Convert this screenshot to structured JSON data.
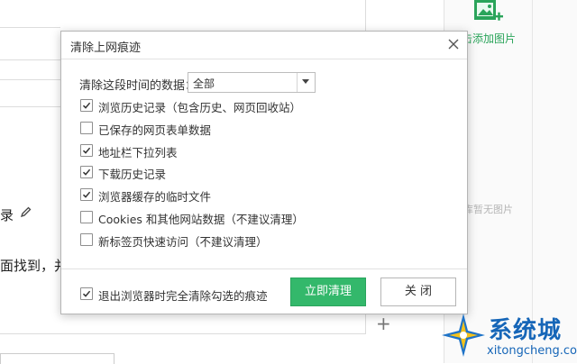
{
  "background": {
    "partial_text_1": "录",
    "partial_text_2": "面找到，并",
    "add_image_label": "击添加图片",
    "no_image_text": "库暂无图片"
  },
  "dialog": {
    "title": "清除上网痕迹",
    "range_label": "清除这段时间的数据：",
    "range_value": "全部",
    "options": [
      {
        "label": "浏览历史记录（包含历史、网页回收站）",
        "checked": true
      },
      {
        "label": "已保存的网页表单数据",
        "checked": false
      },
      {
        "label": "地址栏下拉列表",
        "checked": true
      },
      {
        "label": "下载历史记录",
        "checked": true
      },
      {
        "label": "浏览器缓存的临时文件",
        "checked": true
      },
      {
        "label": "Cookies 和其他网站数据（不建议清理）",
        "checked": false
      },
      {
        "label": "新标签页快速访问（不建议清理）",
        "checked": false
      }
    ],
    "footer_option": {
      "label": "退出浏览器时完全清除勾选的痕迹",
      "checked": true
    },
    "clear_button": "立即清理",
    "close_button": "关 闭"
  },
  "watermark": {
    "text": "系统城",
    "url": "xitongcheng.com"
  },
  "colors": {
    "primary_green": "#33b86b",
    "watermark_blue": "#1666b8"
  }
}
